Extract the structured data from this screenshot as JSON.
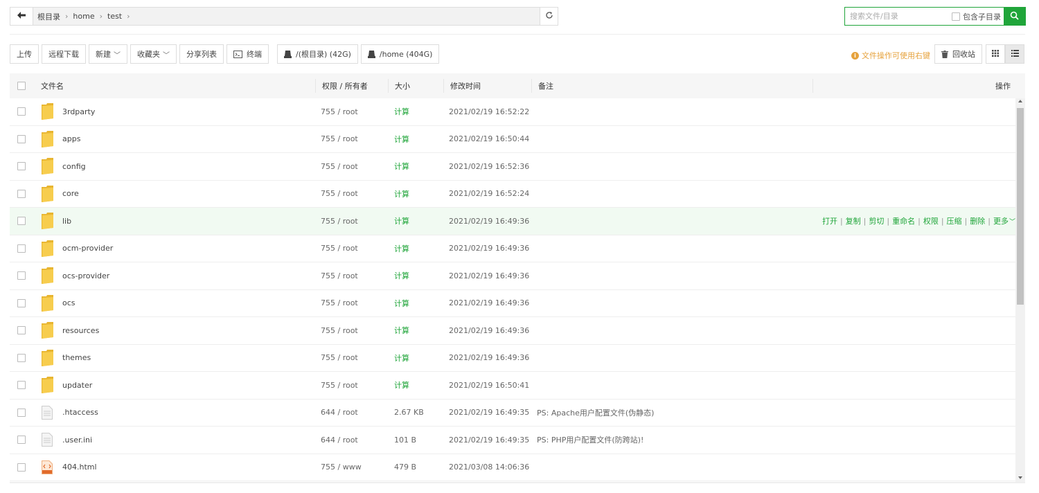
{
  "path": {
    "back_icon": "arrow-left-icon",
    "crumbs": [
      "根目录",
      "home",
      "test"
    ],
    "separator": "›",
    "refresh_icon": "refresh-icon"
  },
  "search": {
    "placeholder": "搜索文件/目录",
    "include_sub_label": "包含子目录",
    "button_icon": "search-icon"
  },
  "toolbar": {
    "upload": "上传",
    "remote_download": "远程下载",
    "new": "新建",
    "favorites": "收藏夹",
    "share_list": "分享列表",
    "terminal": "终端",
    "disk_root": "/(根目录) (42G)",
    "disk_home": "/home (404G)",
    "tip": "文件操作可使用右键",
    "recycle": "回收站"
  },
  "table": {
    "headers": {
      "name": "文件名",
      "perm": "权限 / 所有者",
      "size": "大小",
      "mtime": "修改时间",
      "note": "备注",
      "ops": "操作"
    },
    "rows": [
      {
        "type": "folder",
        "name": "3rdparty",
        "perm": "755 / root",
        "size": "计算",
        "mtime": "2021/02/19 16:52:22",
        "note": ""
      },
      {
        "type": "folder",
        "name": "apps",
        "perm": "755 / root",
        "size": "计算",
        "mtime": "2021/02/19 16:50:44",
        "note": ""
      },
      {
        "type": "folder",
        "name": "config",
        "perm": "755 / root",
        "size": "计算",
        "mtime": "2021/02/19 16:52:36",
        "note": ""
      },
      {
        "type": "folder",
        "name": "core",
        "perm": "755 / root",
        "size": "计算",
        "mtime": "2021/02/19 16:52:24",
        "note": ""
      },
      {
        "type": "folder",
        "name": "lib",
        "perm": "755 / root",
        "size": "计算",
        "mtime": "2021/02/19 16:49:36",
        "note": "",
        "hover": true
      },
      {
        "type": "folder",
        "name": "ocm-provider",
        "perm": "755 / root",
        "size": "计算",
        "mtime": "2021/02/19 16:49:36",
        "note": ""
      },
      {
        "type": "folder",
        "name": "ocs-provider",
        "perm": "755 / root",
        "size": "计算",
        "mtime": "2021/02/19 16:49:36",
        "note": ""
      },
      {
        "type": "folder",
        "name": "ocs",
        "perm": "755 / root",
        "size": "计算",
        "mtime": "2021/02/19 16:49:36",
        "note": ""
      },
      {
        "type": "folder",
        "name": "resources",
        "perm": "755 / root",
        "size": "计算",
        "mtime": "2021/02/19 16:49:36",
        "note": ""
      },
      {
        "type": "folder",
        "name": "themes",
        "perm": "755 / root",
        "size": "计算",
        "mtime": "2021/02/19 16:49:36",
        "note": ""
      },
      {
        "type": "folder",
        "name": "updater",
        "perm": "755 / root",
        "size": "计算",
        "mtime": "2021/02/19 16:50:41",
        "note": ""
      },
      {
        "type": "file",
        "name": ".htaccess",
        "perm": "644 / root",
        "size": "2.67 KB",
        "mtime": "2021/02/19 16:49:35",
        "note": "PS: Apache用户配置文件(伪静态)"
      },
      {
        "type": "file",
        "name": ".user.ini",
        "perm": "644 / root",
        "size": "101 B",
        "mtime": "2021/02/19 16:49:35",
        "note": "PS: PHP用户配置文件(防跨站)!"
      },
      {
        "type": "html",
        "name": "404.html",
        "perm": "755 / www",
        "size": "479 B",
        "mtime": "2021/03/08 14:06:36",
        "note": ""
      }
    ],
    "row_ops": [
      "打开",
      "复制",
      "剪切",
      "重命名",
      "权限",
      "压缩",
      "删除",
      "更多"
    ]
  },
  "colors": {
    "accent": "#20a53a",
    "tip": "#e6a23c",
    "folder": "#f5c342"
  }
}
